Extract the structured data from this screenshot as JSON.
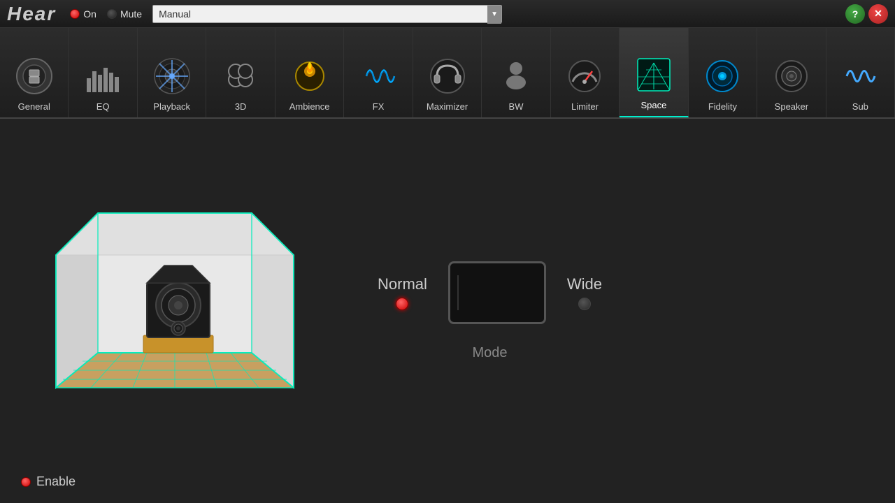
{
  "app": {
    "logo": "Hear",
    "header": {
      "on_label": "On",
      "mute_label": "Mute",
      "preset_label": "Manual",
      "help_icon": "?",
      "close_icon": "✕"
    }
  },
  "tabs": [
    {
      "id": "general",
      "label": "General",
      "active": false
    },
    {
      "id": "eq",
      "label": "EQ",
      "active": false
    },
    {
      "id": "playback",
      "label": "Playback",
      "active": false
    },
    {
      "id": "3d",
      "label": "3D",
      "active": false
    },
    {
      "id": "ambience",
      "label": "Ambience",
      "active": false
    },
    {
      "id": "fx",
      "label": "FX",
      "active": false
    },
    {
      "id": "maximizer",
      "label": "Maximizer",
      "active": false
    },
    {
      "id": "bw",
      "label": "BW",
      "active": false
    },
    {
      "id": "limiter",
      "label": "Limiter",
      "active": false
    },
    {
      "id": "space",
      "label": "Space",
      "active": true
    },
    {
      "id": "fidelity",
      "label": "Fidelity",
      "active": false
    },
    {
      "id": "speaker",
      "label": "Speaker",
      "active": false
    },
    {
      "id": "sub",
      "label": "Sub",
      "active": false
    }
  ],
  "space": {
    "normal_label": "Normal",
    "wide_label": "Wide",
    "mode_label": "Mode",
    "normal_active": true,
    "wide_active": false
  },
  "footer": {
    "enable_label": "Enable"
  }
}
